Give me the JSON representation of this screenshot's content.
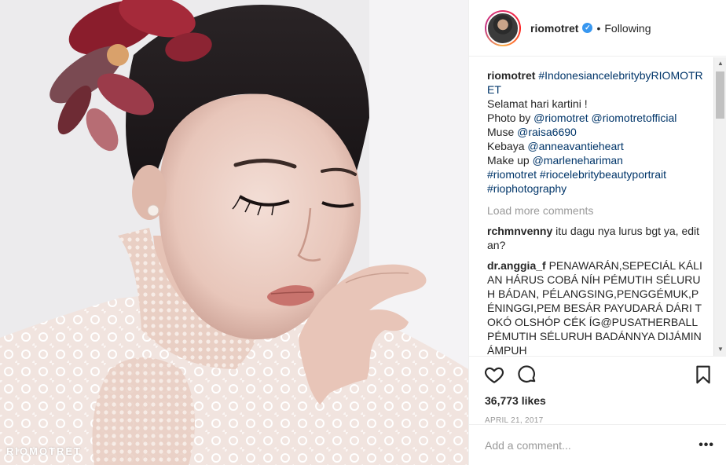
{
  "photo": {
    "watermark": "RIOMOTRET",
    "alt": "riomotret photo"
  },
  "header": {
    "username": "riomotret",
    "verified_mark": "✓",
    "separator": "•",
    "follow_status": "Following"
  },
  "caption": {
    "username": "riomotret",
    "lines": [
      {
        "text": "#IndonesiancelebritybyRIOMOTRET",
        "style": "tag"
      },
      {
        "text": "Selamat hari kartini !",
        "style": "plain"
      },
      {
        "text": "Photo by ",
        "style": "plain",
        "tags": [
          "@riomotret",
          "@riomotretofficial"
        ]
      },
      {
        "text": "Muse ",
        "style": "plain",
        "tags": [
          "@raisa6690"
        ]
      },
      {
        "text": "Kebaya ",
        "style": "plain",
        "tags": [
          "@anneavantieheart"
        ]
      },
      {
        "text": "Make up ",
        "style": "plain",
        "tags": [
          "@marlenehariman"
        ]
      },
      {
        "text": "",
        "style": "plain",
        "tags": [
          "#riomotret",
          "#riocelebritybeautyportrait"
        ]
      },
      {
        "text": "",
        "style": "plain",
        "tags": [
          "#riophotography"
        ]
      }
    ]
  },
  "load_more": "Load more comments",
  "comments": [
    {
      "username": "rchmnvenny",
      "text": "itu dagu nya lurus bgt ya, editan?"
    },
    {
      "username": "dr.anggia_f",
      "text": "PENAWARÁN,SEPECIÁL KÁLIAN HÁRUS COBÁ NÍH PÉMUTIH SÉLURUH BÁDAN, PÉLANGSING,PENGGÉMUK,PÉNINGGI,PEM BESÁR PAYUDARÁ DÁRI TOKÓ OLSHÓP CÉK ÍG@PUSATHERBALL PÉMUTIH SÉLURUH BADÁNNYA DIJÁMIN ÁMPUH"
    }
  ],
  "actions": {
    "like_icon": "heart-icon",
    "comment_icon": "speech-bubble-icon",
    "save_icon": "bookmark-icon",
    "likes": "36,773 likes",
    "date": "APRIL 21, 2017"
  },
  "add_comment": {
    "placeholder": "Add a comment...",
    "more": "•••"
  },
  "colors": {
    "link": "#003569",
    "muted": "#999999",
    "text": "#262626",
    "verified": "#3897f0",
    "border": "#efefef"
  }
}
